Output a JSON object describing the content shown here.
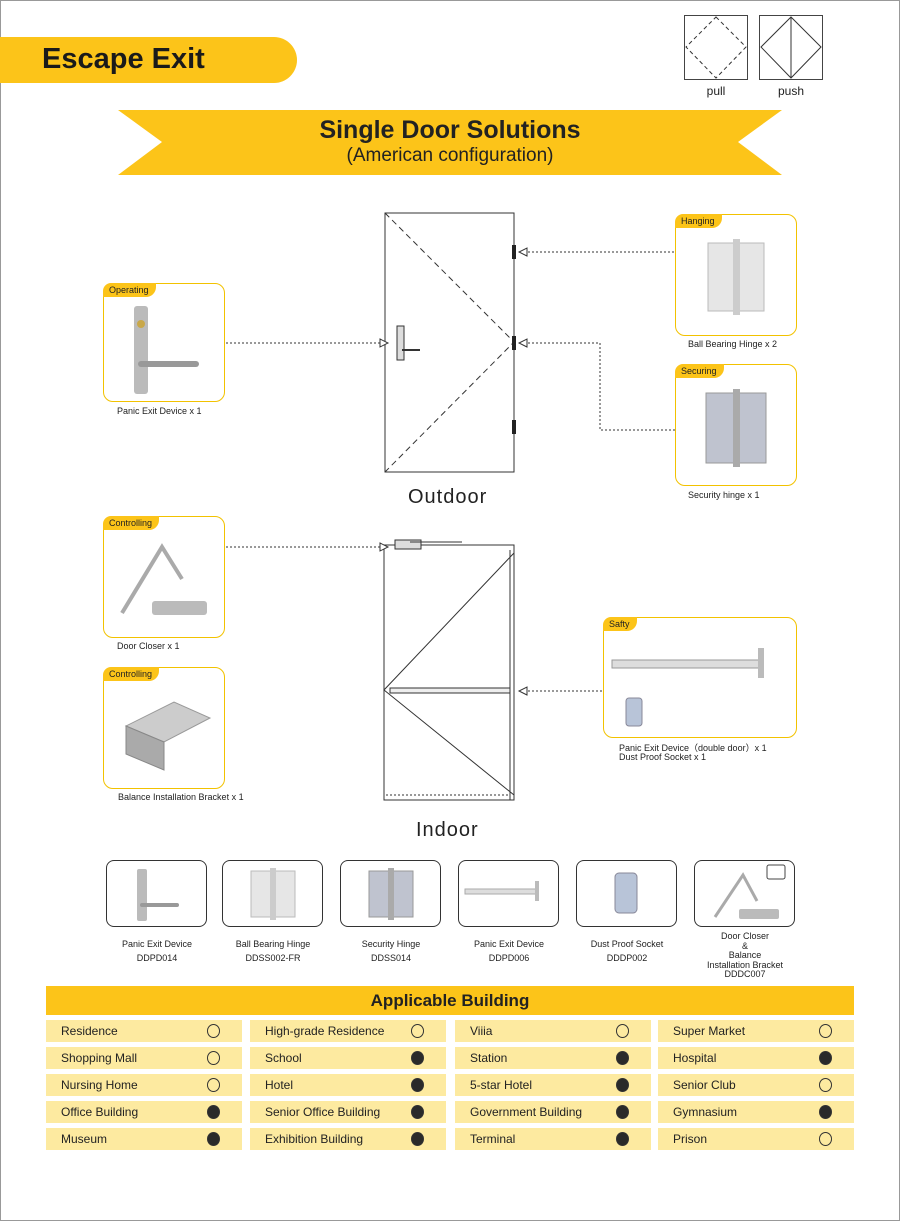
{
  "header": {
    "title": "Escape Exit",
    "pull_label": "pull",
    "push_label": "push"
  },
  "banner": {
    "title": "Single Door Solutions",
    "subtitle": "(American configuration)"
  },
  "outdoor": {
    "label": "Outdoor",
    "operating": {
      "tag": "Operating",
      "caption": "Panic Exit Device x 1"
    },
    "hanging": {
      "tag": "Hanging",
      "caption": "Ball Bearing Hinge x 2"
    },
    "securing": {
      "tag": "Securing",
      "caption": "Security hinge x 1"
    }
  },
  "indoor": {
    "label": "Indoor",
    "closer": {
      "tag": "Controlling",
      "caption": "Door Closer x 1"
    },
    "bracket": {
      "tag": "Controlling",
      "caption": "Balance Installation Bracket x 1"
    },
    "safety": {
      "tag": "Safty",
      "caption1": "Panic  Exit  Device（double  door）x 1",
      "caption2": "Dust  Proof Socket  x 1"
    }
  },
  "products": [
    {
      "name": "Panic Exit Device",
      "code": "DDPD014",
      "icon": "lever-handle-icon"
    },
    {
      "name": "Ball Bearing Hinge",
      "code": "DDSS002-FR",
      "icon": "hinge-icon"
    },
    {
      "name": "Security Hinge",
      "code": "DDSS014",
      "icon": "security-hinge-icon"
    },
    {
      "name": "Panic Exit Device",
      "code": "DDPD006",
      "icon": "panic-bar-icon"
    },
    {
      "name": "Dust Proof Socket",
      "code": "DDDP002",
      "icon": "socket-icon"
    },
    {
      "name": "Door Closer\n&\nBalance\nInstallation Bracket",
      "code": "DDDC007",
      "icon": "door-closer-icon"
    }
  ],
  "applicable": {
    "title": "Applicable Building",
    "rows": [
      [
        {
          "n": "Residence",
          "on": false
        },
        {
          "n": "High-grade Residence",
          "on": false
        },
        {
          "n": "Viiia",
          "on": false
        },
        {
          "n": "Super Market",
          "on": false
        }
      ],
      [
        {
          "n": "Shopping Mall",
          "on": false
        },
        {
          "n": "School",
          "on": true
        },
        {
          "n": "Station",
          "on": true
        },
        {
          "n": "Hospital",
          "on": true
        }
      ],
      [
        {
          "n": "Nursing Home",
          "on": false
        },
        {
          "n": "Hotel",
          "on": true
        },
        {
          "n": "5-star Hotel",
          "on": true
        },
        {
          "n": "Senior Club",
          "on": false
        }
      ],
      [
        {
          "n": "Office Building",
          "on": true
        },
        {
          "n": "Senior Office Building",
          "on": true
        },
        {
          "n": "Government Building",
          "on": true
        },
        {
          "n": "Gymnasium",
          "on": true
        }
      ],
      [
        {
          "n": "Museum",
          "on": true
        },
        {
          "n": "Exhibition Building",
          "on": true
        },
        {
          "n": "Terminal",
          "on": true
        },
        {
          "n": "Prison",
          "on": false
        }
      ]
    ]
  },
  "colors": {
    "accent": "#fcc419",
    "cell": "#fdeaa0"
  }
}
